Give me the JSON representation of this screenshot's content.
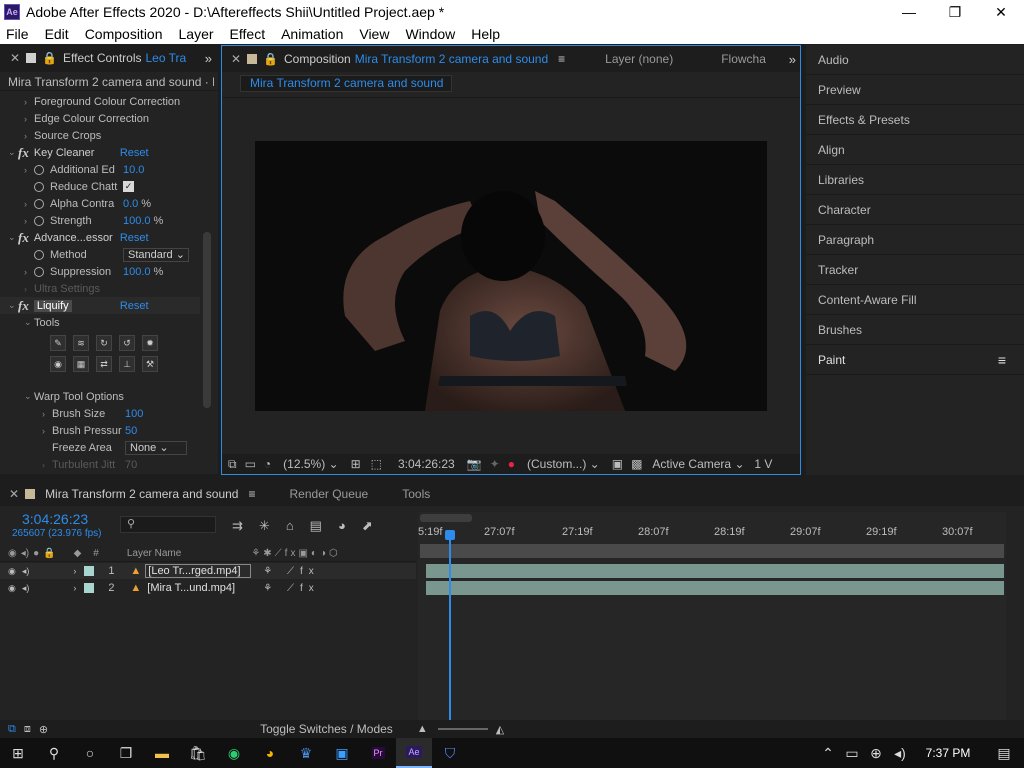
{
  "window": {
    "app_icon": "Ae",
    "title": "Adobe After Effects 2020 - D:\\Aftereffects Shii\\Untitled Project.aep *"
  },
  "menu": [
    "File",
    "Edit",
    "Composition",
    "Layer",
    "Effect",
    "Animation",
    "View",
    "Window",
    "Help"
  ],
  "effect_controls": {
    "tab_label": "Effect Controls",
    "tab_target": "Leo Tra",
    "breadcrumb": "Mira Transform 2 camera and sound · Leo",
    "rows": [
      {
        "kind": "group",
        "label": "Foreground Colour Correction"
      },
      {
        "kind": "group",
        "label": "Edge Colour Correction"
      },
      {
        "kind": "group",
        "label": "Source Crops"
      },
      {
        "kind": "fx",
        "label": "Key Cleaner",
        "reset": "Reset"
      },
      {
        "kind": "prop",
        "label": "Additional Ed",
        "value": "10.0",
        "unit": ""
      },
      {
        "kind": "check",
        "label": "Reduce Chatt"
      },
      {
        "kind": "prop",
        "label": "Alpha Contra",
        "value": "0.0",
        "unit": "%"
      },
      {
        "kind": "prop",
        "label": "Strength",
        "value": "100.0",
        "unit": "%"
      },
      {
        "kind": "fx",
        "label": "Advance...essor",
        "reset": "Reset"
      },
      {
        "kind": "select",
        "label": "Method",
        "value": "Standard"
      },
      {
        "kind": "prop",
        "label": "Suppression",
        "value": "100.0",
        "unit": "%"
      },
      {
        "kind": "dim",
        "label": "Ultra Settings"
      },
      {
        "kind": "fx",
        "label": "Liquify",
        "reset": "Reset"
      },
      {
        "kind": "sub",
        "label": "Tools"
      }
    ],
    "warp": {
      "section": "Warp Tool Options",
      "brush_size_label": "Brush Size",
      "brush_size": "100",
      "brush_pressure_label": "Brush Pressur",
      "brush_pressure": "50",
      "freeze_area_label": "Freeze Area",
      "freeze_area": "None",
      "turbulent_label": "Turbulent Jitt",
      "turbulent": "70"
    }
  },
  "composition": {
    "tab_label": "Composition",
    "tab_target": "Mira Transform 2 camera and sound",
    "layer_tab": "Layer (none)",
    "flow_tab": "Flowcha",
    "subtab": "Mira Transform 2 camera and sound",
    "zoom": "(12.5%)",
    "timecode": "3:04:26:23",
    "resolution": "(Custom...)",
    "camera": "Active Camera",
    "views": "1 V"
  },
  "right_panel": [
    "Audio",
    "Preview",
    "Effects & Presets",
    "Align",
    "Libraries",
    "Character",
    "Paragraph",
    "Tracker",
    "Content-Aware Fill",
    "Brushes",
    "Paint"
  ],
  "timeline": {
    "comp_tab": "Mira Transform 2 camera and sound",
    "render_tab": "Render Queue",
    "tools_tab": "Tools",
    "timecode": "3:04:26:23",
    "frames": "265607 (23.976 fps)",
    "col_layer_name": "Layer Name",
    "col_hash": "#",
    "ruler": [
      "5:19f",
      "27:07f",
      "27:19f",
      "28:07f",
      "28:19f",
      "29:07f",
      "29:19f",
      "30:07f"
    ],
    "layers": [
      {
        "num": "1",
        "name": "[Leo Tr...rged.mp4]",
        "color": "#a8d6cf"
      },
      {
        "num": "2",
        "name": "[Mira T...und.mp4]",
        "color": "#a8d6cf"
      }
    ],
    "toggle": "Toggle Switches / Modes"
  },
  "taskbar": {
    "time": "7:37 PM"
  }
}
